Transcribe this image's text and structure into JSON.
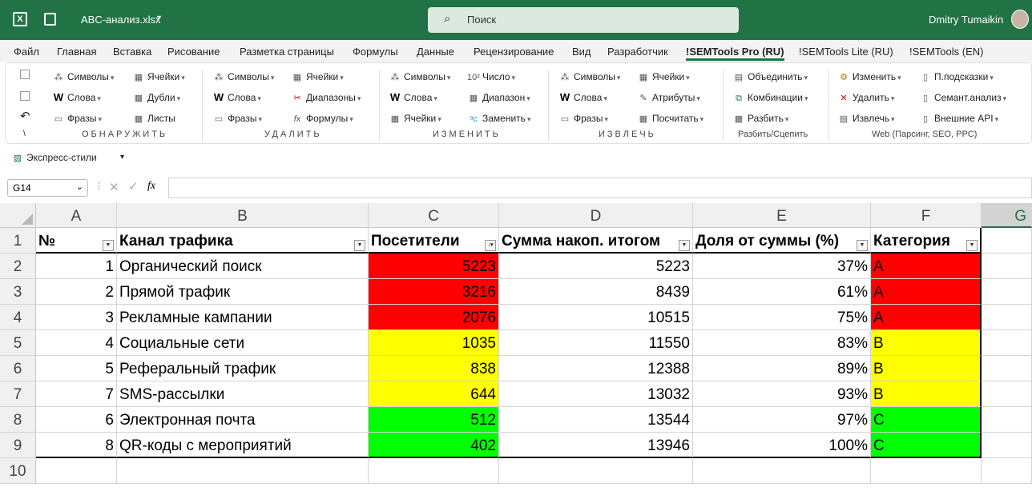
{
  "app": {
    "filename": "ABC-анализ.xlsx",
    "search_placeholder": "Поиск",
    "user": "Dmitry Tumaikin"
  },
  "menu": [
    "Файл",
    "Главная",
    "Вставка",
    "Рисование",
    "Разметка страницы",
    "Формулы",
    "Данные",
    "Рецензирование",
    "Вид",
    "Разработчик",
    "!SEMTools Pro (RU)",
    "!SEMTools Lite (RU)",
    "!SEMTools (EN)"
  ],
  "ribbon": {
    "g1": {
      "a": [
        "Символы",
        "Слова",
        "Фразы"
      ],
      "b": [
        "Ячейки",
        "Дубли",
        "Листы"
      ],
      "label": "ОБНАРУЖИТЬ"
    },
    "g2": {
      "a": [
        "Символы",
        "Слова",
        "Фразы"
      ],
      "b": [
        "Ячейки",
        "Диапазоны",
        "Формулы"
      ],
      "label": "УДАЛИТЬ"
    },
    "g3": {
      "a": [
        "Символы",
        "Слова",
        "Ячейки"
      ],
      "b": [
        "Число",
        "Диапазон",
        "Заменить"
      ],
      "label": "ИЗМЕНИТЬ"
    },
    "g4": {
      "a": [
        "Символы",
        "Слова",
        "Фразы"
      ],
      "b": [
        "Ячейки",
        "Атрибуты",
        "Посчитать"
      ],
      "label": "ИЗВЛЕЧЬ"
    },
    "g5": {
      "a": [
        "Объединить",
        "Комбинации",
        "Разбить"
      ],
      "label": "Разбить/Сцепить"
    },
    "g6": {
      "a": [
        "Изменить",
        "Удалить",
        "Извлечь"
      ],
      "b": [
        "П.подсказки",
        "Семант.анализ",
        "Внешние API"
      ],
      "label": "Web (Парсинг, SEO, PPC)"
    },
    "left_marks": [
      "\\"
    ]
  },
  "styles": {
    "label": "Экспресс-стили"
  },
  "formula": {
    "namebox": "G14",
    "fx": "fx",
    "value": ""
  },
  "columns": [
    "A",
    "B",
    "C",
    "D",
    "E",
    "F",
    "G"
  ],
  "headers": [
    "№",
    "Канал трафика",
    "Посетители",
    "Сумма накоп. итогом",
    "Доля от суммы (%)",
    "Категория"
  ],
  "rows": [
    {
      "n": "1",
      "ch": "Органический поиск",
      "v": "5223",
      "s": "5223",
      "p": "37%",
      "c": "A",
      "k": "red"
    },
    {
      "n": "2",
      "ch": "Прямой трафик",
      "v": "3216",
      "s": "8439",
      "p": "61%",
      "c": "A",
      "k": "red"
    },
    {
      "n": "3",
      "ch": "Рекламные кампании",
      "v": "2076",
      "s": "10515",
      "p": "75%",
      "c": "A",
      "k": "red"
    },
    {
      "n": "4",
      "ch": "Социальные сети",
      "v": "1035",
      "s": "11550",
      "p": "83%",
      "c": "B",
      "k": "yel"
    },
    {
      "n": "5",
      "ch": "Реферальный трафик",
      "v": "838",
      "s": "12388",
      "p": "89%",
      "c": "B",
      "k": "yel"
    },
    {
      "n": "7",
      "ch": "SMS-рассылки",
      "v": "644",
      "s": "13032",
      "p": "93%",
      "c": "B",
      "k": "yel"
    },
    {
      "n": "6",
      "ch": "Электронная почта",
      "v": "512",
      "s": "13544",
      "p": "97%",
      "c": "C",
      "k": "grn"
    },
    {
      "n": "8",
      "ch": "QR-коды с мероприятий",
      "v": "402",
      "s": "13946",
      "p": "100%",
      "c": "C",
      "k": "grn"
    }
  ],
  "row_numbers": [
    "1",
    "2",
    "3",
    "4",
    "5",
    "6",
    "7",
    "8",
    "9",
    "10"
  ],
  "colors": {
    "excel_green": "#217346",
    "cat_a": "#ff0000",
    "cat_b": "#ffff00",
    "cat_c": "#00ff00"
  }
}
